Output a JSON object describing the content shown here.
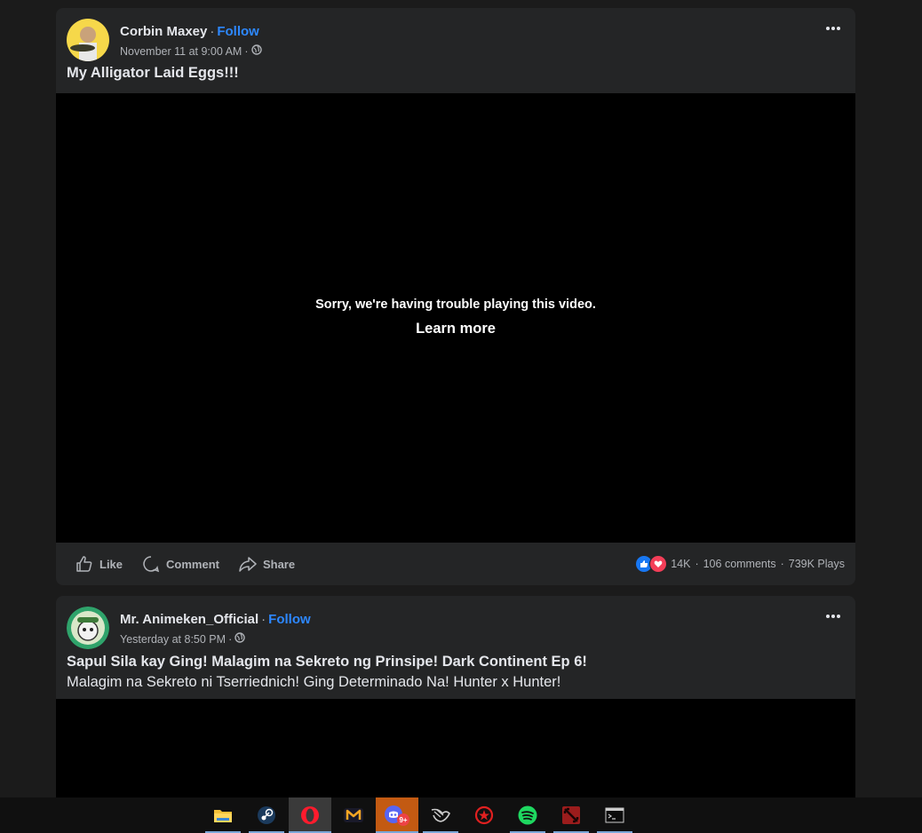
{
  "posts": [
    {
      "author": "Corbin Maxey",
      "follow_label": "Follow",
      "date": "November 11 at 9:00 AM",
      "title": "My Alligator Laid Eggs!!!",
      "video_error": "Sorry, we're having trouble playing this video.",
      "learn_more": "Learn more",
      "actions": {
        "like": "Like",
        "comment": "Comment",
        "share": "Share"
      },
      "stats": {
        "reactions": "14K",
        "comments": "106 comments",
        "plays": "739K Plays"
      }
    },
    {
      "author": "Mr. Animeken_Official",
      "follow_label": "Follow",
      "date": "Yesterday at 8:50 PM",
      "title": "Sapul Sila kay Ging! Malagim na Sekreto ng Prinsipe! Dark Continent Ep 6!",
      "body": "Malagim na Sekreto ni Tserriednich! Ging Determinado Na! Hunter x Hunter!"
    }
  ],
  "taskbar": {
    "apps": [
      "file-explorer",
      "steam",
      "opera",
      "gaming-app",
      "discord",
      "app-launcher",
      "rockstar-launcher",
      "spotify",
      "dota-2",
      "terminal"
    ],
    "discord_badge": "9+"
  },
  "colors": {
    "accent": "#2d88ff",
    "card": "#242526",
    "background": "#1b1b1b"
  }
}
